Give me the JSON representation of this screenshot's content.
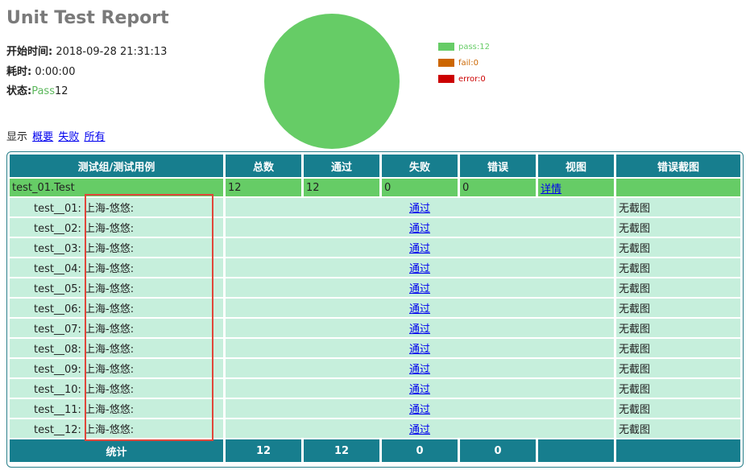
{
  "report": {
    "title": "Unit Test Report",
    "start_label": "开始时间:",
    "start_value": "2018-09-28 21:31:13",
    "duration_label": "耗时:",
    "duration_value": "0:00:00",
    "status_label": "状态:",
    "status_pass_word": "Pass",
    "status_pass_count": "12"
  },
  "legend": [
    {
      "label": "pass:12",
      "color": "#66cc66"
    },
    {
      "label": "fail:0",
      "color": "#cc6600"
    },
    {
      "label": "error:0",
      "color": "#cc0000"
    }
  ],
  "filters": {
    "prefix": "显示",
    "summary": "概要",
    "failed": "失败",
    "all": "所有"
  },
  "table": {
    "headers": [
      "测试组/测试用例",
      "总数",
      "通过",
      "失败",
      "错误",
      "视图",
      "错误截图"
    ],
    "suite": {
      "name": "test_01.Test",
      "total": "12",
      "pass": "12",
      "fail": "0",
      "error": "0",
      "view": "详情",
      "screenshot": ""
    },
    "cases": [
      {
        "name": "test__01: 上海-悠悠:",
        "result": "通过",
        "screenshot": "无截图"
      },
      {
        "name": "test__02: 上海-悠悠:",
        "result": "通过",
        "screenshot": "无截图"
      },
      {
        "name": "test__03: 上海-悠悠:",
        "result": "通过",
        "screenshot": "无截图"
      },
      {
        "name": "test__04: 上海-悠悠:",
        "result": "通过",
        "screenshot": "无截图"
      },
      {
        "name": "test__05: 上海-悠悠:",
        "result": "通过",
        "screenshot": "无截图"
      },
      {
        "name": "test__06: 上海-悠悠:",
        "result": "通过",
        "screenshot": "无截图"
      },
      {
        "name": "test__07: 上海-悠悠:",
        "result": "通过",
        "screenshot": "无截图"
      },
      {
        "name": "test__08: 上海-悠悠:",
        "result": "通过",
        "screenshot": "无截图"
      },
      {
        "name": "test__09: 上海-悠悠:",
        "result": "通过",
        "screenshot": "无截图"
      },
      {
        "name": "test__10: 上海-悠悠:",
        "result": "通过",
        "screenshot": "无截图"
      },
      {
        "name": "test__11: 上海-悠悠:",
        "result": "通过",
        "screenshot": "无截图"
      },
      {
        "name": "test__12: 上海-悠悠:",
        "result": "通过",
        "screenshot": "无截图"
      }
    ],
    "totals": {
      "label": "统计",
      "total": "12",
      "pass": "12",
      "fail": "0",
      "error": "0",
      "view": "",
      "screenshot": ""
    }
  }
}
